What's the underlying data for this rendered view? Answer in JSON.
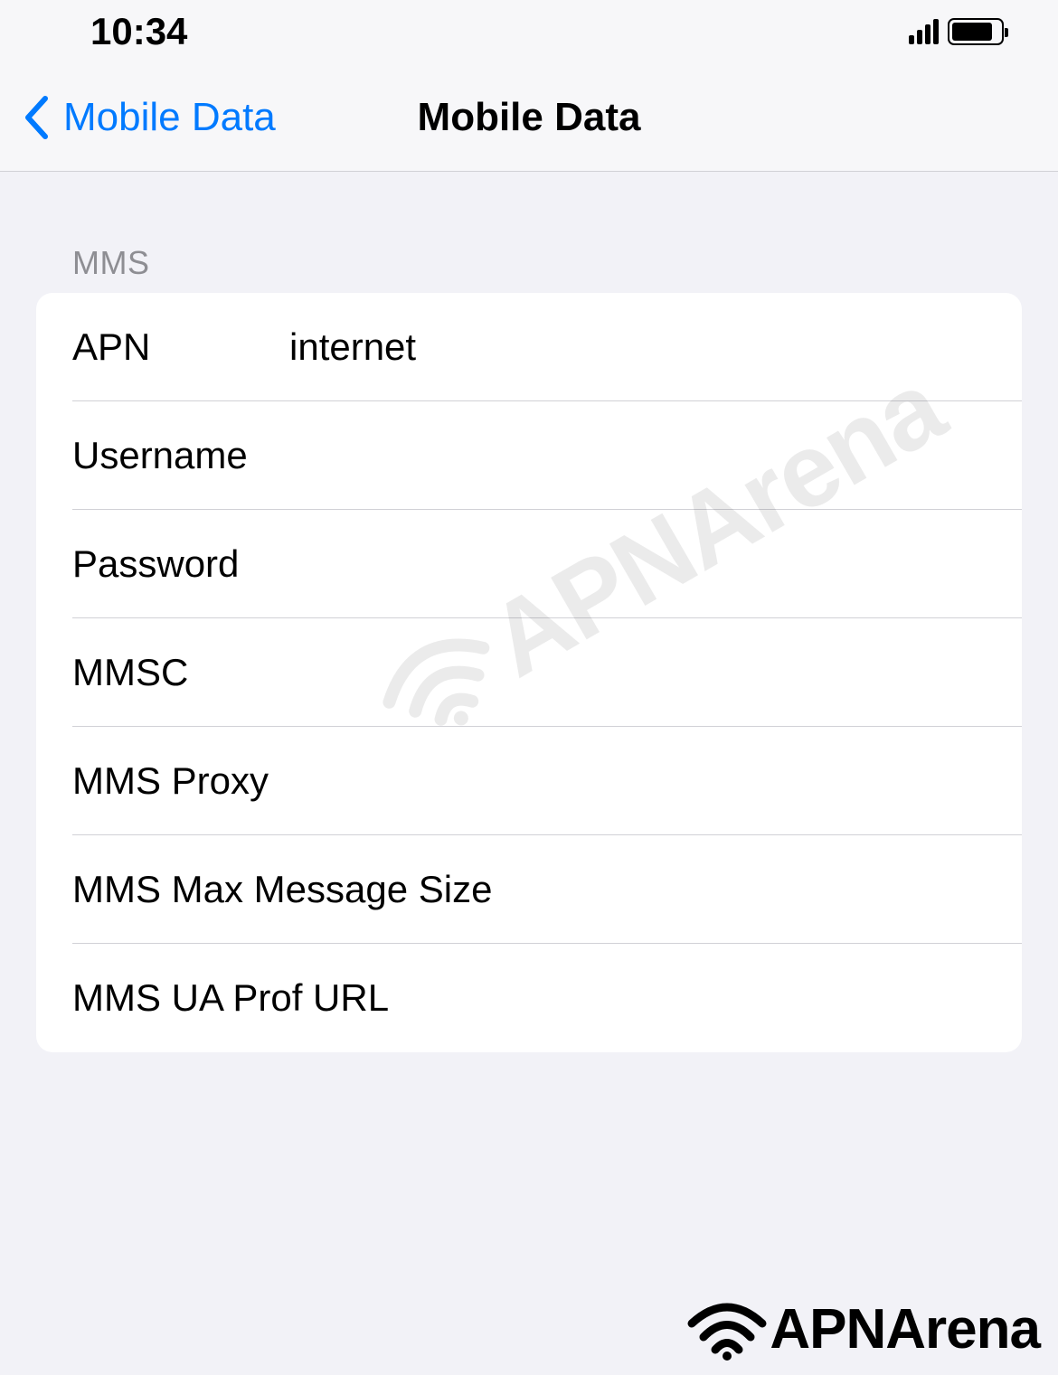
{
  "status_bar": {
    "time": "10:34"
  },
  "nav": {
    "back_label": "Mobile Data",
    "title": "Mobile Data"
  },
  "section": {
    "header": "MMS",
    "rows": [
      {
        "label": "APN",
        "value": "internet"
      },
      {
        "label": "Username",
        "value": ""
      },
      {
        "label": "Password",
        "value": ""
      },
      {
        "label": "MMSC",
        "value": ""
      },
      {
        "label": "MMS Proxy",
        "value": ""
      },
      {
        "label": "MMS Max Message Size",
        "value": ""
      },
      {
        "label": "MMS UA Prof URL",
        "value": ""
      }
    ]
  },
  "watermark": "APNArena",
  "brand": "APNArena"
}
